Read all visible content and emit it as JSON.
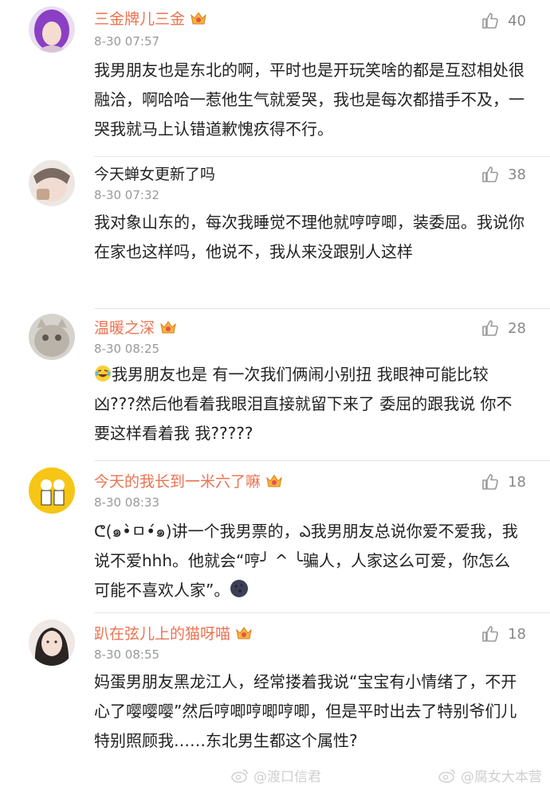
{
  "comments": [
    {
      "name": "三金牌儿三金",
      "time": "8-30 07:57",
      "likes": "40",
      "text": "我男朋友也是东北的啊，平时也是开玩笑啥的都是互怼相处很融洽，啊哈哈一惹他生气就爱哭，我也是每次都措手不及，一哭我就马上认错道歉愧疚得不行。"
    },
    {
      "name": "今天蝉女更新了吗",
      "time": "8-30 07:32",
      "likes": "38",
      "text": "我对象山东的，每次我睡觉不理他就哼哼唧，装委屈。我说你在家也这样吗，他说不，我从来没跟别人这样"
    },
    {
      "name": "温暖之深",
      "time": "8-30 08:25",
      "likes": "28",
      "text": "我男朋友也是 有一次我们俩闹小别扭 我眼神可能比较凶???然后他看着我眼泪直接就留下来了 委屈的跟我说 你不要这样看着我  我?????"
    },
    {
      "name": "今天的我长到一米六了嘛",
      "time": "8-30 08:33",
      "likes": "18",
      "text_a": "ᕦ(๑•̀ㅁ•́๑)讲一个我男票的，ఎ我男朋友总说你爱不爱我，我说不爱hhh。他就会“哼╯ ^ ╰骗人，人家这么可爱，你怎么可能不喜欢人家”。"
    },
    {
      "name": "趴在弦儿上的猫呀喵",
      "time": "8-30 08:55",
      "likes": "18",
      "text": "妈蛋男朋友黑龙江人，经常搂着我说“宝宝有小情绪了，不开心了嘤嘤嘤”然后哼唧哼唧哼唧，但是平时出去了特别爷们儿特别照顾我……东北男生都这个属性?"
    }
  ],
  "watermarks": {
    "left": "@渡口信君",
    "right": "@腐女大本营"
  },
  "colors": {
    "name": "#eb7350",
    "meta": "#999999",
    "text": "#222222"
  }
}
